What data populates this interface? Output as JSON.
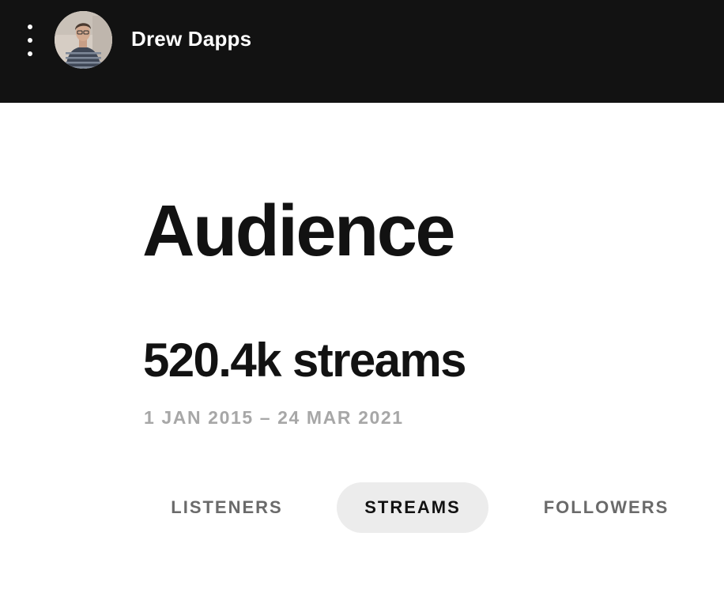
{
  "header": {
    "menu_icon": "vertical-ellipsis-icon",
    "user_name": "Drew Dapps",
    "avatar": "user-avatar-photo",
    "background_color": "#121212"
  },
  "main": {
    "title": "Audience",
    "stat_value": "520.4k streams",
    "date_range": "1 JAN 2015 – 24 MAR 2021"
  },
  "tabs": [
    {
      "label": "LISTENERS",
      "active": false
    },
    {
      "label": "STREAMS",
      "active": true
    },
    {
      "label": "FOLLOWERS",
      "active": false
    }
  ],
  "colors": {
    "text_primary": "#121212",
    "text_muted": "#a7a7a7",
    "tab_inactive": "#6a6a6a",
    "tab_active_bg": "#ececec"
  }
}
